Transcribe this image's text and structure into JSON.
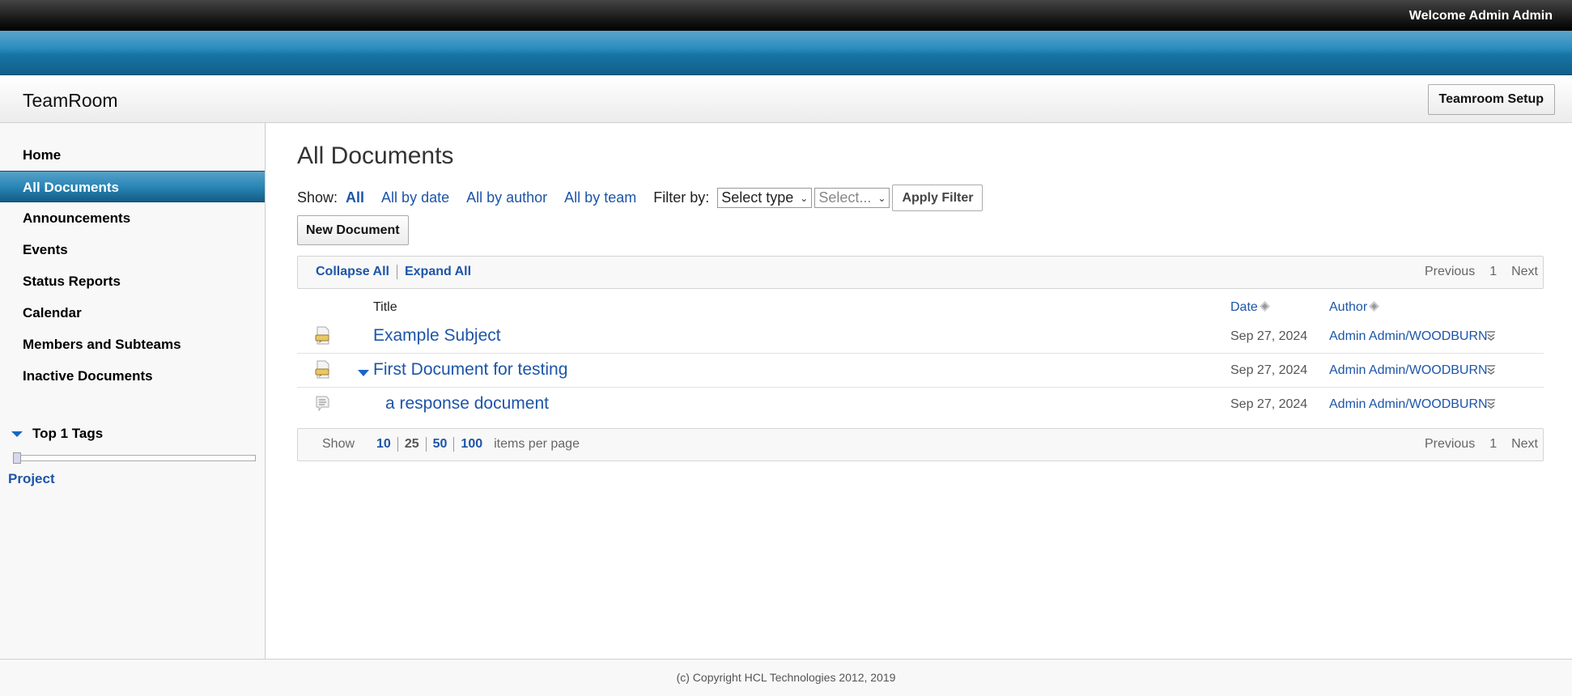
{
  "header": {
    "welcome": "Welcome Admin Admin",
    "app_title": "TeamRoom",
    "setup_button": "Teamroom Setup"
  },
  "sidebar": {
    "items": [
      {
        "label": "Home",
        "active": false
      },
      {
        "label": "All Documents",
        "active": true
      },
      {
        "label": "Announcements",
        "active": false
      },
      {
        "label": "Events",
        "active": false
      },
      {
        "label": "Status Reports",
        "active": false
      },
      {
        "label": "Calendar",
        "active": false
      },
      {
        "label": "Members and Subteams",
        "active": false
      },
      {
        "label": "Inactive Documents",
        "active": false
      }
    ],
    "tags": {
      "title": "Top 1 Tags",
      "slider_value": 0,
      "items": [
        "Project"
      ]
    }
  },
  "main": {
    "page_title": "All Documents",
    "show_label": "Show:",
    "show_links": [
      "All",
      "All by date",
      "All by author",
      "All by team"
    ],
    "show_selected": "All",
    "filter_label": "Filter by:",
    "filter_type_value": "Select type",
    "filter_value_placeholder": "Select...",
    "apply_filter": "Apply Filter",
    "new_document": "New Document",
    "toolbar": {
      "collapse_all": "Collapse All",
      "expand_all": "Expand All"
    },
    "pager": {
      "previous": "Previous",
      "page": "1",
      "next": "Next"
    },
    "columns": {
      "title": "Title",
      "date": "Date",
      "author": "Author"
    },
    "rows": [
      {
        "icon": "main-document-icon",
        "title": "Example Subject",
        "date": "Sep 27, 2024",
        "author": "Admin Admin/WOODBURN",
        "expanded": null,
        "level": 0
      },
      {
        "icon": "main-document-icon",
        "title": "First Document for testing",
        "date": "Sep 27, 2024",
        "author": "Admin Admin/WOODBURN",
        "expanded": true,
        "level": 0
      },
      {
        "icon": "response-document-icon",
        "title": "a response document",
        "date": "Sep 27, 2024",
        "author": "Admin Admin/WOODBURN",
        "expanded": null,
        "level": 1
      }
    ],
    "per_page": {
      "show_label": "Show",
      "options": [
        "10",
        "25",
        "50",
        "100"
      ],
      "current": "25",
      "suffix": "items per page"
    }
  },
  "footer": {
    "copyright": "(c) Copyright HCL Technologies 2012, 2019"
  },
  "colors": {
    "link": "#1d55a8",
    "accent_blue": "#2a86b6",
    "topbar": "#1a1a1a"
  }
}
